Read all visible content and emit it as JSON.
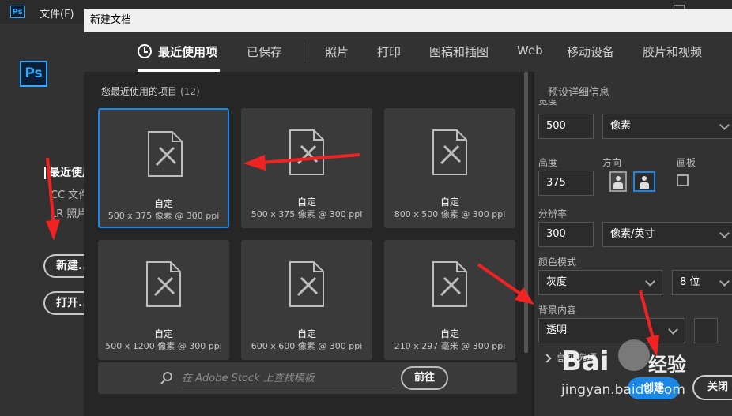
{
  "app": {
    "logo": "Ps",
    "menu_file": "文件(F)"
  },
  "left_panel": {
    "recent_heading": "最近使用项",
    "recent_sub1": "CC 文件",
    "recent_sub2": "LR 照片",
    "new_button": "新建...",
    "open_button": "打开..."
  },
  "dialog": {
    "title": "新建文档",
    "tabs": [
      "最近使用项",
      "已保存",
      "照片",
      "打印",
      "图稿和插图",
      "Web",
      "移动设备",
      "胶片和视频"
    ],
    "section_label": "您最近使用的项目",
    "section_count": "(12)",
    "cards": [
      {
        "name": "自定",
        "size": "500 x 375 像素 @ 300 ppi"
      },
      {
        "name": "自定",
        "size": "500 x 375 像素 @ 300 ppi"
      },
      {
        "name": "自定",
        "size": "800 x 500 像素 @ 300 ppi"
      },
      {
        "name": "自定",
        "size": "500 x 1200 像素 @ 300 ppi"
      },
      {
        "name": "自定",
        "size": "600 x 600 像素 @ 300 ppi"
      },
      {
        "name": "自定",
        "size": "210 x 297 毫米 @ 300 ppi"
      }
    ],
    "search_placeholder": "在 Adobe Stock 上查找模板",
    "go_button": "前往"
  },
  "details": {
    "title": "预设详细信息",
    "width_label": "宽度",
    "width_value": "500",
    "width_unit": "像素",
    "height_label": "高度",
    "height_value": "375",
    "orientation_label": "方向",
    "artboard_label": "画板",
    "resolution_label": "分辨率",
    "resolution_value": "300",
    "resolution_unit": "像素/英寸",
    "color_mode_label": "颜色模式",
    "color_mode_value": "灰度",
    "bit_depth_value": "8 位",
    "background_label": "背景内容",
    "background_value": "透明",
    "advanced_label": "高级选项",
    "create_button": "创建",
    "close_button": "关闭"
  },
  "watermark": {
    "brand": "Bai",
    "brand_cn": "经验",
    "url": "jingyan.baidu.com"
  },
  "colors": {
    "accent": "#1b87e6",
    "arrow": "#f02222",
    "ps_blue": "#31a8ff"
  }
}
